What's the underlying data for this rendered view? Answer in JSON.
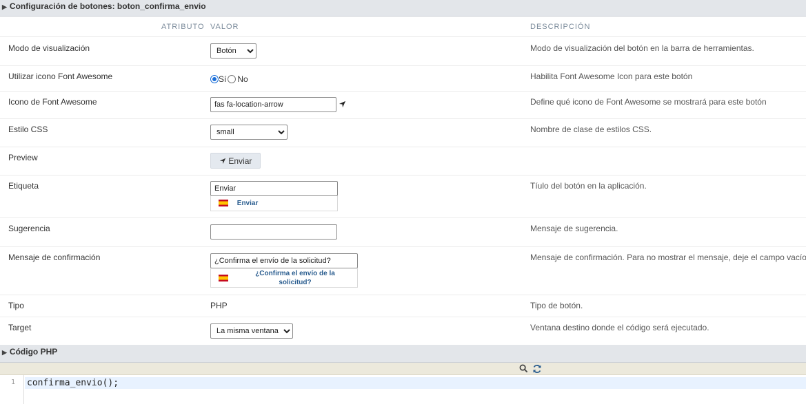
{
  "section_title": "Configuración de botones: boton_confirma_envio",
  "columns": {
    "attribute": "ATRIBUTO",
    "value": "VALOR",
    "description": "DESCRIPCIÓN"
  },
  "rows": {
    "display_mode": {
      "label": "Modo de visualización",
      "value": "Botón",
      "description": "Modo de visualización del botón en la barra de herramientas."
    },
    "use_fa": {
      "label": "Utilizar icono Font Awesome",
      "yes": "Sí",
      "no": "No",
      "selected": "Sí",
      "description": "Habilita Font Awesome Icon para este botón"
    },
    "fa_icon": {
      "label": "Icono de Font Awesome",
      "value": "fas fa-location-arrow",
      "icon": "location-arrow-icon",
      "description": "Define qué icono de Font Awesome se mostrará para este botón"
    },
    "css_style": {
      "label": "Estilo CSS",
      "value": "small",
      "description": "Nombre de clase de estilos CSS."
    },
    "preview": {
      "label": "Preview",
      "button_label": "Enviar"
    },
    "label": {
      "label": "Etiqueta",
      "value": "Enviar",
      "translation": "Enviar",
      "description": "Tíulo del botón en la aplicación."
    },
    "hint": {
      "label": "Sugerencia",
      "value": "",
      "description": "Mensaje de sugerencia."
    },
    "confirm": {
      "label": "Mensaje de confirmación",
      "value": "¿Confirma el envío de la solicitud?",
      "translation_line1": "¿Confirma el envío de la",
      "translation_line2": "solicitud?",
      "description": "Mensaje de confirmación. Para no mostrar el mensaje, deje el campo vacío"
    },
    "type": {
      "label": "Tipo",
      "value": "PHP",
      "description": "Tipo de botón."
    },
    "target": {
      "label": "Target",
      "value": "La misma ventana",
      "description": "Ventana destino donde el código será ejecutado."
    }
  },
  "php_section_title": "Código PHP",
  "editor": {
    "line_number": "1",
    "code": "confirma_envio();"
  },
  "colors": {
    "accent": "#1a6ed8",
    "header_bg": "#e3e6ea",
    "link": "#2a5d8f"
  }
}
